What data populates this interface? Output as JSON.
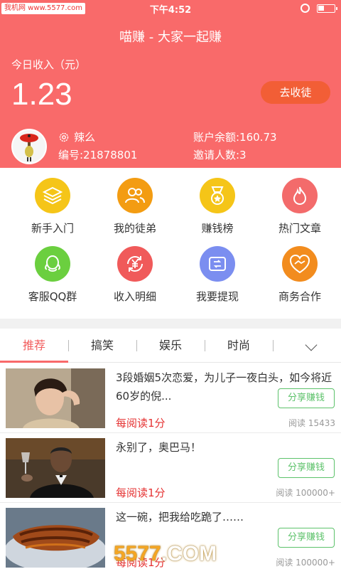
{
  "status_bar": {
    "watermark": "我机网 www.5577.com",
    "time": "下午4:52"
  },
  "header": {
    "title": "喵赚 - 大家一起赚",
    "income_label": "今日收入（元）",
    "income_value": "1.23",
    "recruit_button": "去收徒",
    "nickname": "辣么",
    "user_id": "编号:21878801",
    "balance": "账户余额:160.73",
    "invites": "邀请人数:3"
  },
  "grid": [
    {
      "label": "新手入门",
      "icon": "layers-icon",
      "color": "#f5c518"
    },
    {
      "label": "我的徒弟",
      "icon": "users-icon",
      "color": "#f39c12"
    },
    {
      "label": "赚钱榜",
      "icon": "medal-icon",
      "color": "#f5c518"
    },
    {
      "label": "热门文章",
      "icon": "fire-icon",
      "color": "#f36b6b"
    },
    {
      "label": "客服QQ群",
      "icon": "qq-icon",
      "color": "#6bcf3f"
    },
    {
      "label": "收入明细",
      "icon": "yen-refresh-icon",
      "color": "#f05a5a"
    },
    {
      "label": "我要提现",
      "icon": "wallet-icon",
      "color": "#7b8ef0"
    },
    {
      "label": "商务合作",
      "icon": "handshake-icon",
      "color": "#f28c1e"
    }
  ],
  "tabs": [
    "推荐",
    "搞笑",
    "娱乐",
    "时尚"
  ],
  "articles": [
    {
      "title": "3段婚姻5次恋爱，为儿子一夜白头，如今将近60岁的倪...",
      "reward": "每阅读1分",
      "share": "分享赚钱",
      "reads": "阅读 15433"
    },
    {
      "title": "永别了，奥巴马！",
      "reward": "每阅读1分",
      "share": "分享赚钱",
      "reads": "阅读 100000+"
    },
    {
      "title": "这一碗，把我给吃跪了……",
      "reward": "每阅读1分",
      "share": "分享赚钱",
      "reads": "阅读 100000+"
    }
  ],
  "bottom_watermark": {
    "a": "5577",
    "b": ".COM"
  },
  "colors": {
    "primary": "#f96a6a",
    "accent": "#f25e36",
    "green": "#5cc26a",
    "reward_red": "#e53333"
  }
}
